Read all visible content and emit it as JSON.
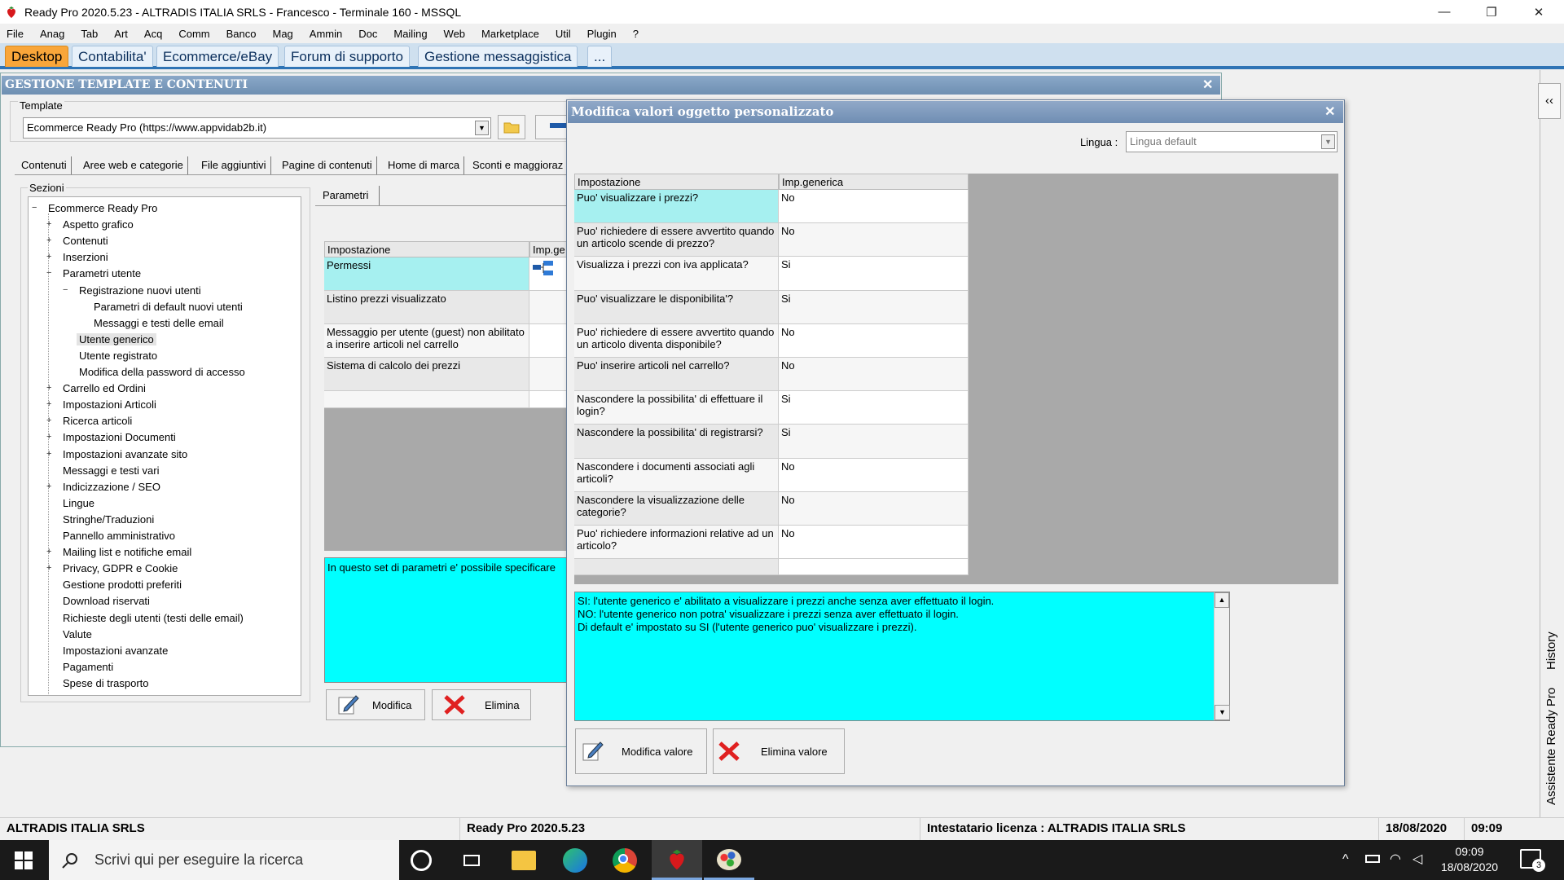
{
  "window": {
    "title": "Ready Pro 2020.5.23 - ALTRADIS ITALIA SRLS - Francesco - Terminale 160 - MSSQL",
    "controls": {
      "minimize": "—",
      "restore": "❐",
      "close": "✕"
    }
  },
  "menu": [
    "File",
    "Anag",
    "Tab",
    "Art",
    "Acq",
    "Comm",
    "Banco",
    "Mag",
    "Ammin",
    "Doc",
    "Mailing",
    "Web",
    "Marketplace",
    "Util",
    "Plugin",
    "?"
  ],
  "top_tabs": [
    {
      "label": "Desktop",
      "active": true
    },
    {
      "label": "Contabilita'"
    },
    {
      "label": "Ecommerce/eBay"
    },
    {
      "label": "Forum di supporto"
    },
    {
      "label": "Gestione messaggistica"
    },
    {
      "label": "..."
    }
  ],
  "panel": {
    "title": "GESTIONE TEMPLATE E CONTENUTI",
    "close": "✕",
    "template_label": "Template",
    "template_value": "Ecommerce Ready Pro (https://www.appvidab2b.it)",
    "subtabs": [
      "Contenuti",
      "Aree web e categorie",
      "File aggiuntivi",
      "Pagine di contenuti",
      "Home di marca",
      "Sconti e maggioraz"
    ],
    "sections_label": "Sezioni",
    "tree": [
      {
        "label": "Ecommerce Ready Pro",
        "level": 0,
        "exp": "−"
      },
      {
        "label": "Aspetto grafico",
        "level": 1,
        "exp": "+"
      },
      {
        "label": "Contenuti",
        "level": 1,
        "exp": "+"
      },
      {
        "label": "Inserzioni",
        "level": 1,
        "exp": "+"
      },
      {
        "label": "Parametri utente",
        "level": 1,
        "exp": "−"
      },
      {
        "label": "Registrazione nuovi utenti",
        "level": 2,
        "exp": "−"
      },
      {
        "label": "Parametri di default nuovi utenti",
        "level": 3,
        "exp": ""
      },
      {
        "label": "Messaggi e testi delle email",
        "level": 3,
        "exp": ""
      },
      {
        "label": "Utente generico",
        "level": 2,
        "exp": "",
        "selected": true
      },
      {
        "label": "Utente registrato",
        "level": 2,
        "exp": ""
      },
      {
        "label": "Modifica della password di accesso",
        "level": 2,
        "exp": ""
      },
      {
        "label": "Carrello ed Ordini",
        "level": 1,
        "exp": "+"
      },
      {
        "label": "Impostazioni Articoli",
        "level": 1,
        "exp": "+"
      },
      {
        "label": "Ricerca articoli",
        "level": 1,
        "exp": "+"
      },
      {
        "label": "Impostazioni Documenti",
        "level": 1,
        "exp": "+"
      },
      {
        "label": "Impostazioni avanzate sito",
        "level": 1,
        "exp": "+"
      },
      {
        "label": "Messaggi e testi vari",
        "level": 1,
        "exp": ""
      },
      {
        "label": "Indicizzazione / SEO",
        "level": 1,
        "exp": "+"
      },
      {
        "label": "Lingue",
        "level": 1,
        "exp": ""
      },
      {
        "label": "Stringhe/Traduzioni",
        "level": 1,
        "exp": ""
      },
      {
        "label": "Pannello amministrativo",
        "level": 1,
        "exp": ""
      },
      {
        "label": "Mailing list e notifiche email",
        "level": 1,
        "exp": "+"
      },
      {
        "label": "Privacy, GDPR e Cookie",
        "level": 1,
        "exp": "+"
      },
      {
        "label": "Gestione prodotti preferiti",
        "level": 1,
        "exp": ""
      },
      {
        "label": "Download riservati",
        "level": 1,
        "exp": ""
      },
      {
        "label": "Richieste degli utenti (testi delle email)",
        "level": 1,
        "exp": ""
      },
      {
        "label": "Valute",
        "level": 1,
        "exp": ""
      },
      {
        "label": "Impostazioni avanzate",
        "level": 1,
        "exp": ""
      },
      {
        "label": "Pagamenti",
        "level": 1,
        "exp": ""
      },
      {
        "label": "Spese di trasporto",
        "level": 1,
        "exp": ""
      }
    ],
    "params_tab": "Parametri",
    "grid_headers": [
      "Impostazione",
      "Imp.ge"
    ],
    "grid_rows": [
      "Permessi",
      "Listino prezzi visualizzato",
      "Messaggio per utente (guest) non abilitato a inserire articoli nel carrello",
      "Sistema di calcolo dei prezzi"
    ],
    "description": "In questo set di parametri e' possibile specificare",
    "edit_button": "Modifica",
    "delete_button": "Elimina"
  },
  "dialog": {
    "title": "Modifica valori oggetto personalizzato",
    "close": "✕",
    "lingua_label": "Lingua :",
    "lingua_value": "Lingua default",
    "headers": [
      "Impostazione",
      "Imp.generica"
    ],
    "rows": [
      {
        "setting": "Puo' visualizzare i prezzi?",
        "value": "No",
        "selected": true
      },
      {
        "setting": "Puo' richiedere di essere avvertito quando un articolo scende di prezzo?",
        "value": "No"
      },
      {
        "setting": "Visualizza i prezzi con iva applicata?",
        "value": "Si"
      },
      {
        "setting": "Puo' visualizzare le disponibilita'?",
        "value": "Si"
      },
      {
        "setting": "Puo' richiedere di essere avvertito quando un articolo diventa disponibile?",
        "value": "No"
      },
      {
        "setting": "Puo' inserire articoli nel carrello?",
        "value": "No"
      },
      {
        "setting": "Nascondere la possibilita' di effettuare il login?",
        "value": "Si"
      },
      {
        "setting": "Nascondere la possibilita' di registrarsi?",
        "value": "Si"
      },
      {
        "setting": "Nascondere i documenti associati agli articoli?",
        "value": "No"
      },
      {
        "setting": "Nascondere la visualizzazione delle categorie?",
        "value": "No"
      },
      {
        "setting": "Puo' richiedere informazioni relative ad un articolo?",
        "value": "No"
      }
    ],
    "description_lines": [
      "SI: l'utente generico e' abilitato a visualizzare i prezzi anche senza aver effettuato il login.",
      "NO: l'utente generico non potra' visualizzare i prezzi senza aver effettuato il login.",
      "Di default e' impostato su SI (l'utente generico puo' visualizzare i prezzi)."
    ],
    "edit_value_button": "Modifica valore",
    "delete_value_button": "Elimina valore"
  },
  "side_panel": {
    "collapse": "‹‹",
    "history": "History",
    "assistant": "Assistente Ready Pro"
  },
  "status": {
    "company": "ALTRADIS ITALIA SRLS",
    "version": "Ready Pro 2020.5.23",
    "license": "Intestatario licenza : ALTRADIS ITALIA SRLS",
    "date": "18/08/2020",
    "time": "09:09"
  },
  "taskbar": {
    "search_placeholder": "Scrivi qui per eseguire la ricerca",
    "clock_time": "09:09",
    "clock_date": "18/08/2020",
    "notifications": "3"
  },
  "colors": {
    "accent_tab": "#f9a63a",
    "highlight": "#00ffff",
    "selected_row": "#a6f0f0",
    "title_gradient": "#7f9bbd"
  }
}
